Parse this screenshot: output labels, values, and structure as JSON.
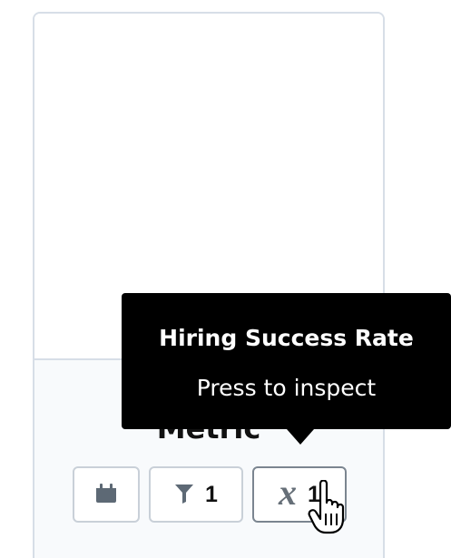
{
  "card": {
    "metric_title": "Metric"
  },
  "controls": {
    "date": {
      "icon": "calendar-icon"
    },
    "filter": {
      "icon": "filter-icon",
      "count": "1"
    },
    "variable": {
      "icon": "variable-icon",
      "symbol": "x",
      "count": "1"
    }
  },
  "tooltip": {
    "title": "Hiring Success Rate",
    "subtitle": "Press to inspect"
  },
  "cursor": {
    "icon": "hand-pointer-icon"
  },
  "colors": {
    "card_border": "#d7dee7",
    "footer_background": "#f8fafc",
    "button_border": "#c9d0d8",
    "active_button_border": "#7b8590",
    "icon_gray": "#5d6975",
    "tooltip_background": "#000000",
    "tooltip_text": "#ffffff"
  }
}
